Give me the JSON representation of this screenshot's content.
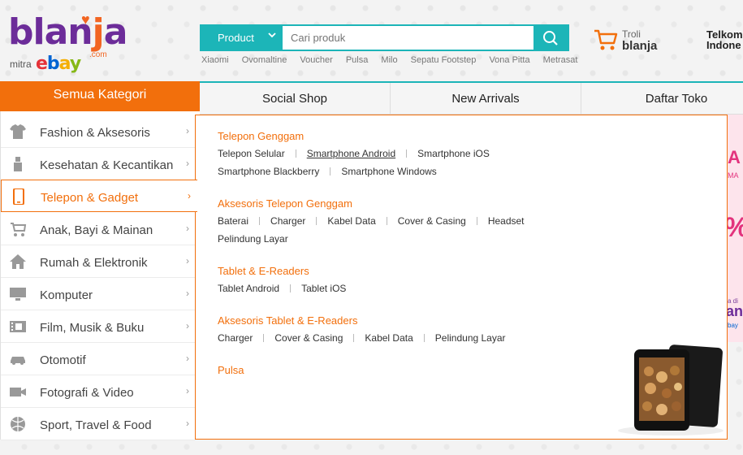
{
  "brand": {
    "logo_text": "blanja",
    "logo_com": ".com",
    "mitra": "mitra",
    "ebay": "ebay"
  },
  "search": {
    "category": "Product",
    "placeholder": "Cari produk",
    "keywords": [
      "Xiaomi",
      "Ovomaltine",
      "Voucher",
      "Pulsa",
      "Milo",
      "Sepatu Footstep",
      "Vona Pitta",
      "Metrasat"
    ]
  },
  "cart": {
    "label": "Troli",
    "brand": "blanja"
  },
  "telkom": {
    "line1": "Telkom",
    "line2": "Indone"
  },
  "nav": {
    "all_categories": "Semua Kategori",
    "tabs": [
      "Social Shop",
      "New Arrivals",
      "Daftar Toko"
    ]
  },
  "categories": [
    {
      "label": "Fashion & Aksesoris",
      "icon": "shirt-icon"
    },
    {
      "label": "Kesehatan & Kecantikan",
      "icon": "lipstick-icon"
    },
    {
      "label": "Telepon & Gadget",
      "icon": "phone-icon",
      "active": true
    },
    {
      "label": "Anak, Bayi & Mainan",
      "icon": "stroller-icon"
    },
    {
      "label": "Rumah & Elektronik",
      "icon": "house-icon"
    },
    {
      "label": "Komputer",
      "icon": "monitor-icon"
    },
    {
      "label": "Film, Musik & Buku",
      "icon": "film-icon"
    },
    {
      "label": "Otomotif",
      "icon": "car-icon"
    },
    {
      "label": "Fotografi & Video",
      "icon": "camera-icon"
    },
    {
      "label": "Sport, Travel & Food",
      "icon": "ball-icon"
    }
  ],
  "arrow": "›",
  "mega": {
    "sections": [
      {
        "title": "Telepon Genggam",
        "rows": [
          [
            "Telepon Selular",
            "Smartphone Android",
            "Smartphone iOS"
          ],
          [
            "Smartphone Blackberry",
            "Smartphone Windows"
          ]
        ]
      },
      {
        "title": "Aksesoris Telepon Genggam",
        "rows": [
          [
            "Baterai",
            "Charger",
            "Kabel Data",
            "Cover & Casing",
            "Headset"
          ],
          [
            "Pelindung Layar"
          ]
        ]
      },
      {
        "title": "Tablet & E-Readers",
        "rows": [
          [
            "Tablet Android",
            "Tablet iOS"
          ]
        ]
      },
      {
        "title": "Aksesoris Tablet & E-Readers",
        "rows": [
          [
            "Charger",
            "Cover & Casing",
            "Kabel Data",
            "Pelindung Layar"
          ]
        ]
      },
      {
        "title": "Pulsa",
        "rows": []
      }
    ],
    "hovered_item": "Smartphone Android"
  },
  "promo_banner": {
    "t1": "A",
    "t2": "MA",
    "t3": "%",
    "t4": "a di",
    "t5": "an",
    "t6": "bay"
  },
  "colors": {
    "accent": "#f26f0c",
    "teal": "#1cb5b8",
    "purple": "#6c2c99"
  }
}
